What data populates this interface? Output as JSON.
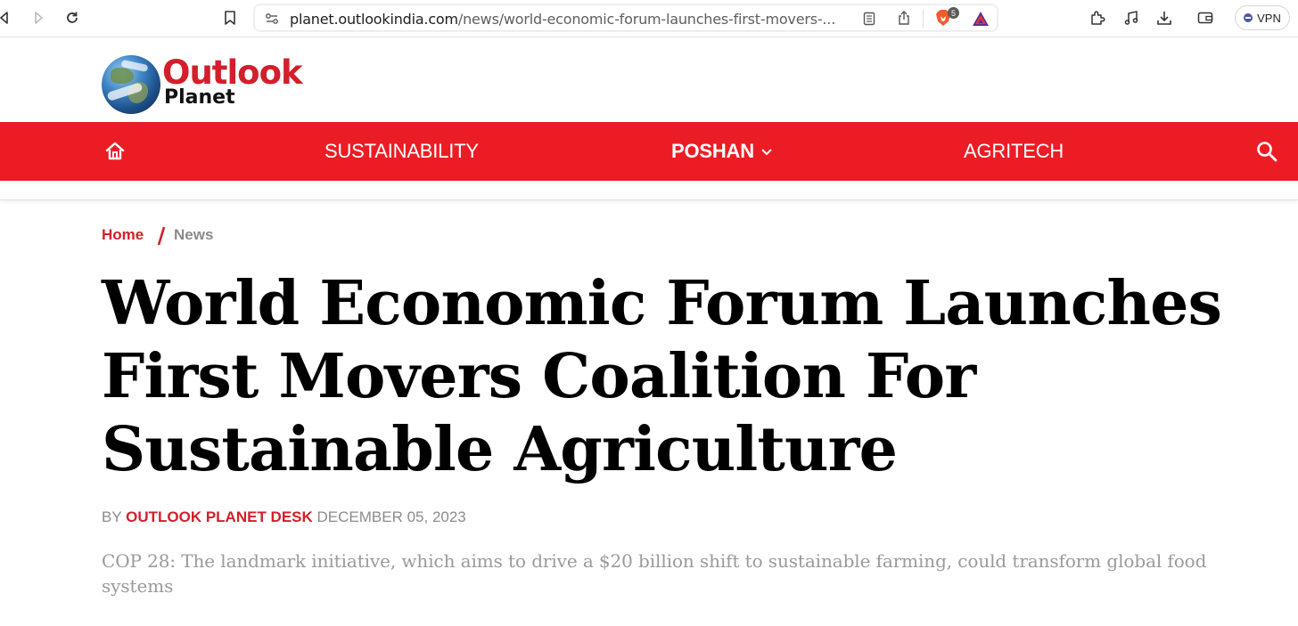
{
  "browser": {
    "url_host": "planet.outlookindia.com",
    "url_path": "/news/world-economic-forum-launches-first-movers-...",
    "shields_count": "5",
    "vpn_label": "VPN"
  },
  "site": {
    "logo_main": "Outlook",
    "logo_sub": "Planet",
    "brand_color": "#ec1c24"
  },
  "nav": {
    "items": [
      {
        "label": "SUSTAINABILITY",
        "bold": false
      },
      {
        "label": "POSHAN",
        "bold": true,
        "has_dropdown": true
      },
      {
        "label": "AGRITECH",
        "bold": false
      }
    ]
  },
  "breadcrumb": {
    "home": "Home",
    "separator": "/",
    "current": "News"
  },
  "article": {
    "title": "World Economic Forum Launches First Movers Coalition For Sustainable Agriculture",
    "byline_prefix": "BY",
    "author": "OUTLOOK PLANET DESK",
    "date": "DECEMBER 05, 2023",
    "summary": "COP 28: The landmark initiative, which aims to drive a $20 billion shift to sustainable farming, could transform global food systems"
  }
}
